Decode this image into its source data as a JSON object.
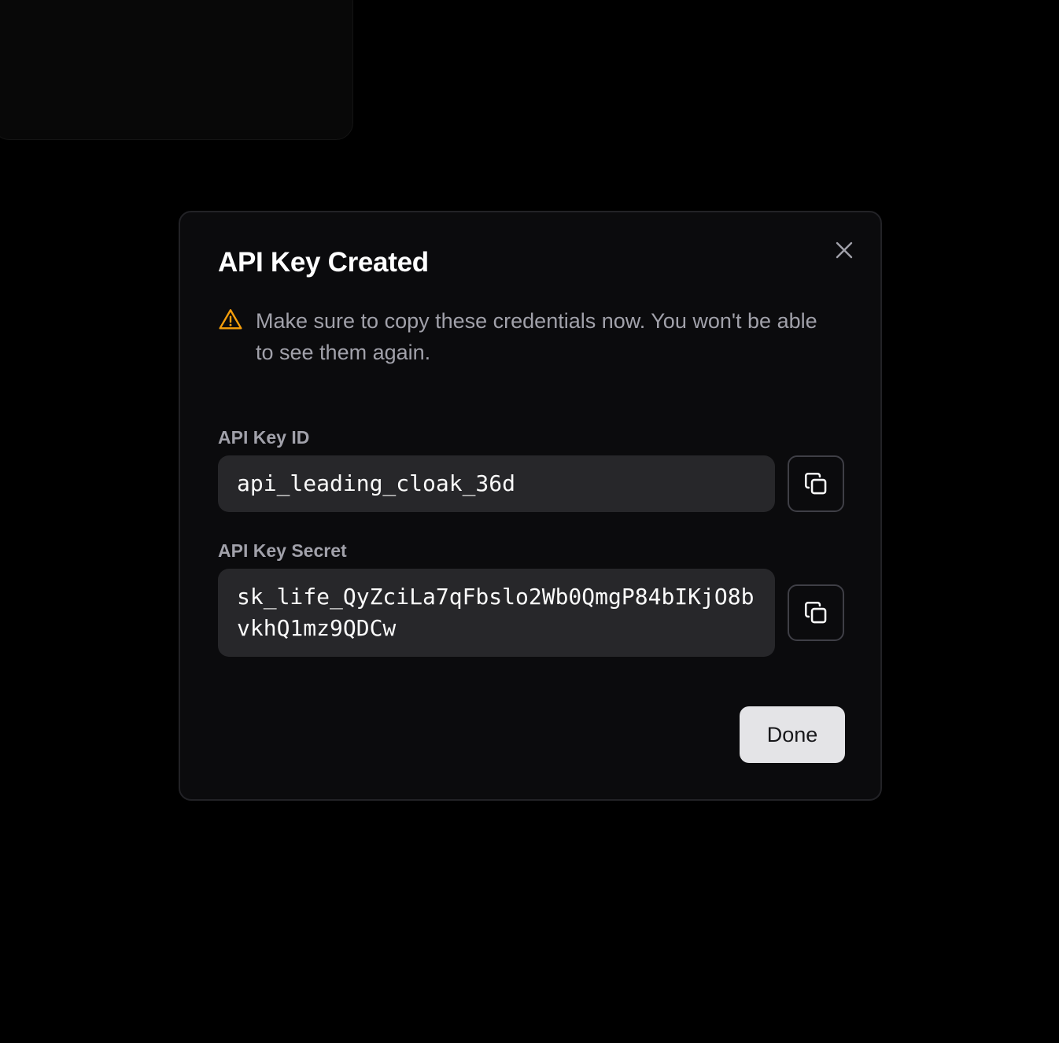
{
  "dialog": {
    "title": "API Key Created",
    "warning_text": "Make sure to copy these credentials now. You won't be able to see them again.",
    "done_label": "Done"
  },
  "fields": {
    "key_id": {
      "label": "API Key ID",
      "value": "api_leading_cloak_36d"
    },
    "key_secret": {
      "label": "API Key Secret",
      "value": "sk_life_QyZciLa7qFbslo2Wb0QmgP84bIKjO8bvkhQ1mz9QDCw"
    }
  },
  "icons": {
    "close": "close-icon",
    "warning": "warning-triangle-icon",
    "copy": "copy-icon"
  },
  "colors": {
    "warning": "#f59e0b",
    "background": "#000000",
    "dialog_background": "#0b0b0d",
    "field_background": "#27272a",
    "primary_button": "#e4e4e7"
  }
}
